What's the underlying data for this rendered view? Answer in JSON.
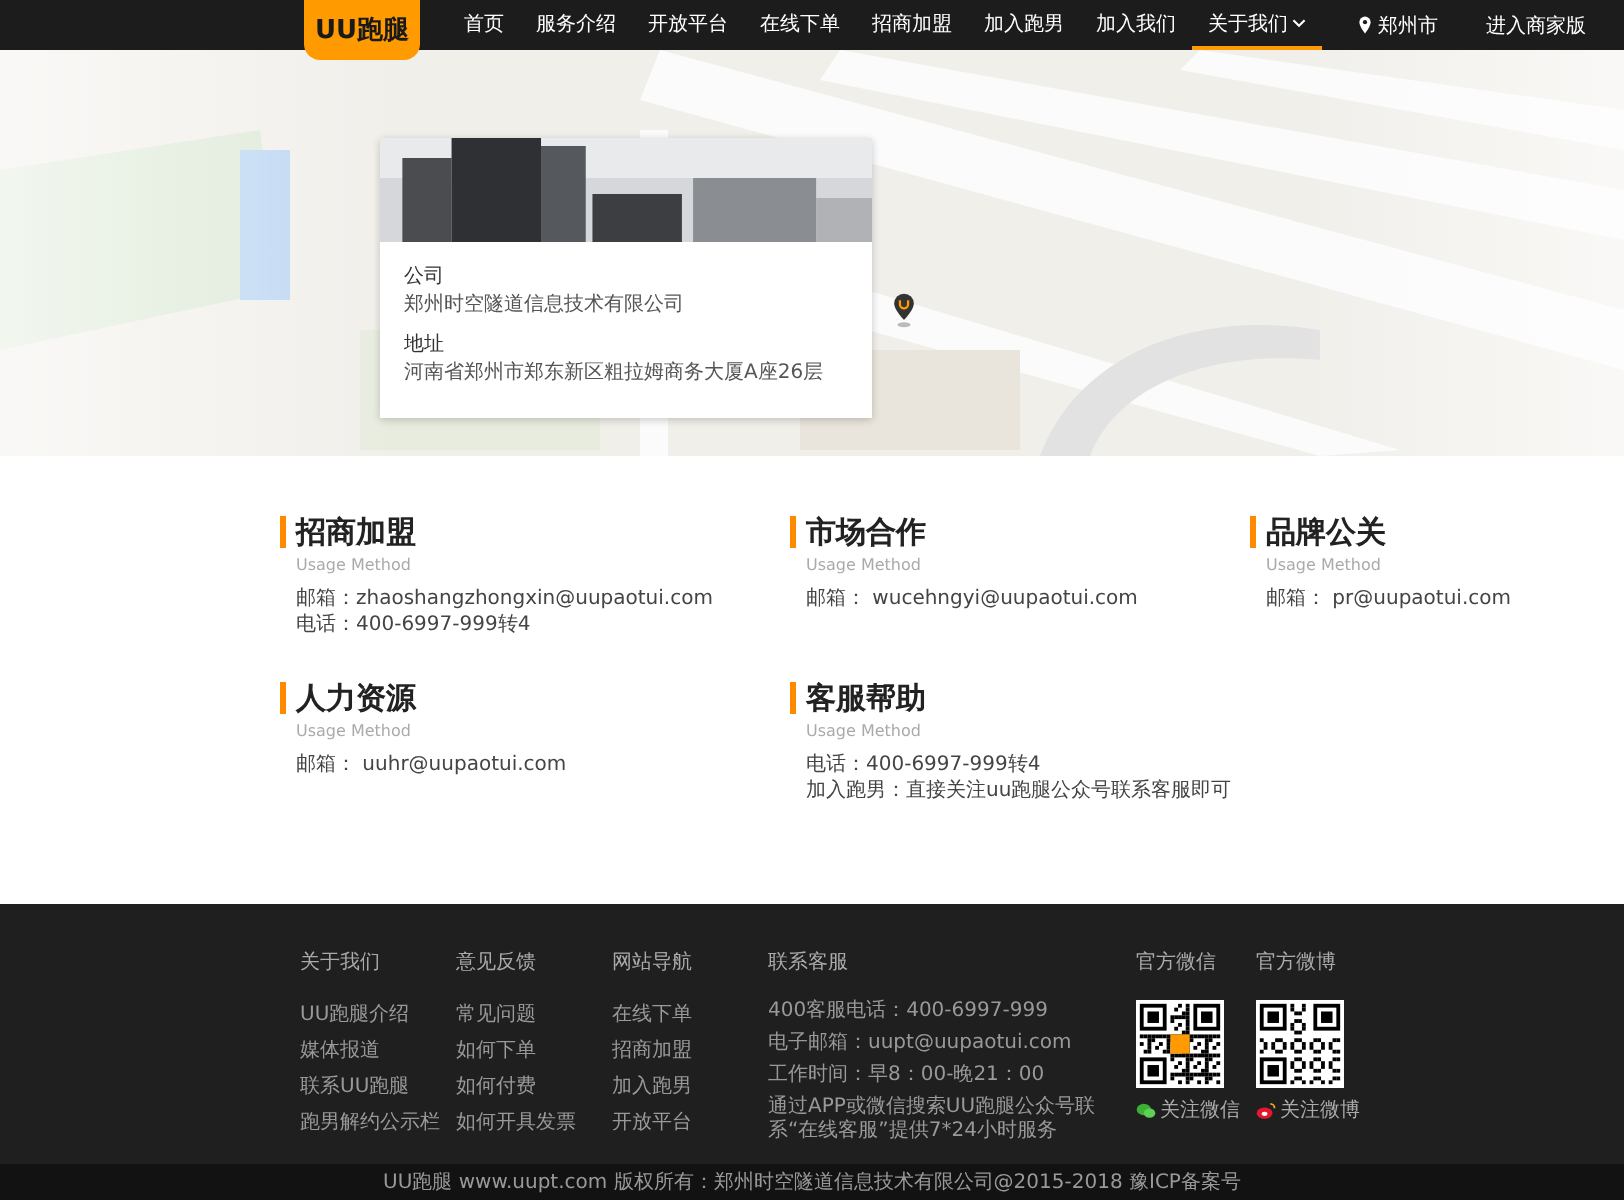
{
  "nav": {
    "logo": "UU跑腿",
    "items": [
      {
        "label": "首页",
        "selected": false,
        "has_menu": false
      },
      {
        "label": "服务介绍",
        "selected": false,
        "has_menu": false
      },
      {
        "label": "开放平台",
        "selected": false,
        "has_menu": false
      },
      {
        "label": "在线下单",
        "selected": false,
        "has_menu": false
      },
      {
        "label": "招商加盟",
        "selected": false,
        "has_menu": false
      },
      {
        "label": "加入跑男",
        "selected": false,
        "has_menu": false
      },
      {
        "label": "加入我们",
        "selected": false,
        "has_menu": false
      },
      {
        "label": "关于我们",
        "selected": true,
        "has_menu": true
      }
    ],
    "city": "郑州市",
    "merchant": "进入商家版"
  },
  "map": {
    "card": [
      {
        "label": "公司",
        "value": "郑州时空隧道信息技术有限公司"
      },
      {
        "label": "地址",
        "value": "河南省郑州市郑东新区粗拉姆商务大厦A座26层"
      }
    ]
  },
  "contacts": [
    {
      "title": "招商加盟",
      "subtitle": "Usage Method",
      "lines": [
        "邮箱：zhaoshangzhongxin@uupaotui.com",
        "电话：400-6997-999转4"
      ]
    },
    {
      "title": "市场合作",
      "subtitle": "Usage Method",
      "lines": [
        "邮箱： wucehngyi@uupaotui.com"
      ]
    },
    {
      "title": "品牌公关",
      "subtitle": "Usage Method",
      "lines": [
        "邮箱： pr@uupaotui.com"
      ]
    },
    {
      "title": "人力资源",
      "subtitle": "Usage Method",
      "lines": [
        "邮箱： uuhr@uupaotui.com"
      ]
    },
    {
      "title": "客服帮助",
      "subtitle": "Usage Method",
      "lines": [
        "电话：400-6997-999转4",
        "加入跑男：直接关注uu跑腿公众号联系客服即可"
      ]
    }
  ],
  "footer": {
    "columns": [
      {
        "heading": "关于我们",
        "links": [
          "UU跑腿介绍",
          "媒体报道",
          "联系UU跑腿",
          "跑男解约公示栏"
        ]
      },
      {
        "heading": "意见反馈",
        "links": [
          "常见问题",
          "如何下单",
          "如何付费",
          "如何开具发票"
        ]
      },
      {
        "heading": "网站导航",
        "links": [
          "在线下单",
          "招商加盟",
          "加入跑男",
          "开放平台"
        ]
      }
    ],
    "service": {
      "heading": "联系客服",
      "lines": [
        "400客服电话：400-6997-999",
        "电子邮箱：uupt@uupaotui.com",
        "工作时间：早8：00-晚21：00",
        "通过APP或微信搜索UU跑腿公众号联系“在线客服”提供7*24小时服务"
      ]
    },
    "social": [
      {
        "kind": "wechat",
        "heading": "官方微信",
        "caption": "关注微信"
      },
      {
        "kind": "weibo",
        "heading": "官方微博",
        "caption": "关注微博"
      }
    ]
  },
  "copyright": "UU跑腿 www.uupt.com 版权所有：郑州时空隧道信息技术有限公司@2015-2018 豫ICP备案号"
}
